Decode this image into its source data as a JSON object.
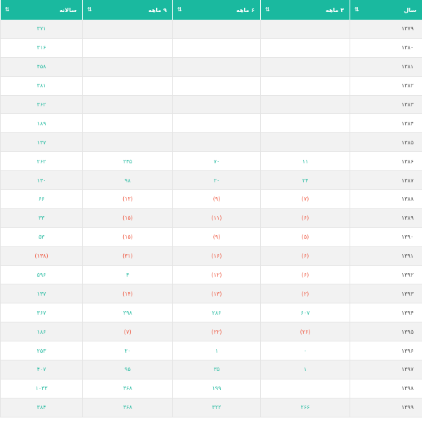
{
  "table": {
    "headers": [
      "سال",
      "۳ ماهه",
      "۶ ماهه",
      "۹ ماهه",
      "سالانه"
    ],
    "colors": {
      "header_bg": "#1ab99f",
      "positive": "#2bbca3",
      "negative": "#ee5b44",
      "row_alt": "#f2f2f2"
    },
    "sort_icon": "sort-arrows-icon",
    "rows": [
      {
        "year": "۱۳۷۹",
        "q3": "",
        "q6": "",
        "q9": "",
        "annual": "۳۷۱"
      },
      {
        "year": "۱۳۸۰",
        "q3": "",
        "q6": "",
        "q9": "",
        "annual": "۳۱۶"
      },
      {
        "year": "۱۳۸۱",
        "q3": "",
        "q6": "",
        "q9": "",
        "annual": "۴۵۸"
      },
      {
        "year": "۱۳۸۲",
        "q3": "",
        "q6": "",
        "q9": "",
        "annual": "۳۸۱"
      },
      {
        "year": "۱۳۸۳",
        "q3": "",
        "q6": "",
        "q9": "",
        "annual": "۳۶۲"
      },
      {
        "year": "۱۳۸۴",
        "q3": "",
        "q6": "",
        "q9": "",
        "annual": "۱۸۹"
      },
      {
        "year": "۱۳۸۵",
        "q3": "",
        "q6": "",
        "q9": "",
        "annual": "۱۳۷"
      },
      {
        "year": "۱۳۸۶",
        "q3": "۱۱",
        "q6": "۷۰",
        "q9": "۲۴۵",
        "annual": "۲۶۲"
      },
      {
        "year": "۱۳۸۷",
        "q3": "۲۴",
        "q6": "۲۰",
        "q9": "۹۸",
        "annual": "۱۳۰"
      },
      {
        "year": "۱۳۸۸",
        "q3": "(۷)",
        "q6": "(۹)",
        "q9": "(۱۲)",
        "annual": "۶۶"
      },
      {
        "year": "۱۳۸۹",
        "q3": "(۶)",
        "q6": "(۱۱)",
        "q9": "(۱۵)",
        "annual": "۳۳"
      },
      {
        "year": "۱۳۹۰",
        "q3": "(۵)",
        "q6": "(۹)",
        "q9": "(۱۵)",
        "annual": "۵۳"
      },
      {
        "year": "۱۳۹۱",
        "q3": "(۶)",
        "q6": "(۱۶)",
        "q9": "(۳۱)",
        "annual": "(۱۳۸)"
      },
      {
        "year": "۱۳۹۲",
        "q3": "(۶)",
        "q6": "(۱۲)",
        "q9": "۴",
        "annual": "۵۹۶"
      },
      {
        "year": "۱۳۹۳",
        "q3": "(۲)",
        "q6": "(۱۳)",
        "q9": "(۱۴)",
        "annual": "۱۳۷"
      },
      {
        "year": "۱۳۹۴",
        "q3": "۶۰۷",
        "q6": "۲۸۶",
        "q9": "۲۹۸",
        "annual": "۳۶۷"
      },
      {
        "year": "۱۳۹۵",
        "q3": "(۲۶)",
        "q6": "(۲۲)",
        "q9": "(۷)",
        "annual": "۱۸۶"
      },
      {
        "year": "۱۳۹۶",
        "q3": "۰",
        "q6": "۱",
        "q9": "۲۰",
        "annual": "۲۵۳"
      },
      {
        "year": "۱۳۹۷",
        "q3": "۱",
        "q6": "۳۵",
        "q9": "۹۵",
        "annual": "۴۰۷"
      },
      {
        "year": "۱۳۹۸",
        "q3": "",
        "q6": "۱۹۹",
        "q9": "۳۶۸",
        "annual": "۱۰۳۳"
      },
      {
        "year": "۱۳۹۹",
        "q3": "۲۶۶",
        "q6": "۳۲۲",
        "q9": "۳۶۸",
        "annual": "۳۸۴"
      }
    ]
  }
}
